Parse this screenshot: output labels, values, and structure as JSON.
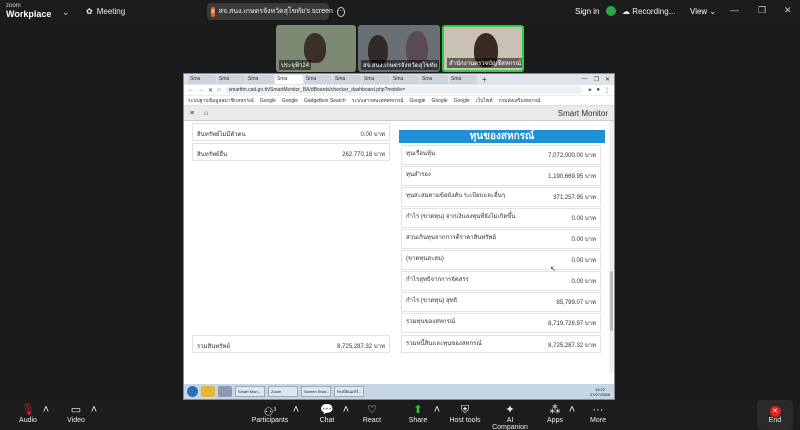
{
  "zoom": {
    "logo_top": "zoom",
    "logo_bottom": "Workplace",
    "meeting_label": "Meeting",
    "share_title": "สจ.สนง.เกษตรจังหวัดสุโขทัย's screen",
    "share_initial": "ส",
    "sign_in": "Sign in",
    "recording": "Recording...",
    "view": "View",
    "participants_count": "3",
    "colors": {
      "active_border": "#2ecc40",
      "share_green": "#28a745",
      "end_red": "#e02020"
    }
  },
  "tiles": [
    {
      "name": "ประจุฟ้า24"
    },
    {
      "name": "สจ.สนง.เกษตรจังหวัดสุโขทัย"
    },
    {
      "name": "สำนักงานตรวจบัญชีสหกรณ์..."
    }
  ],
  "browser": {
    "tabs": [
      "Sma",
      "Sma",
      "Sma",
      "Sma",
      "Sma",
      "Sma",
      "Sma",
      "Sma",
      "Sma",
      "Sma"
    ],
    "url": "smartfm.cad.go.th/SmartMonitor_BA/dBoards/checker_dashboard.php?mobile=",
    "bookmarks": [
      "ระบบฐานข้อมูลสมาชิกสหกรณ์",
      "Google",
      "Google",
      "Gadgetbox Search",
      "ระบบสารสนเทศสหกรณ์",
      "Google",
      "Google",
      "Google",
      "เว็บไซต์",
      "กรมส่งเสริมสหกรณ์"
    ],
    "app_title": "Smart Monitor",
    "menu_icon": "hamburger-icon",
    "home_icon": "home-icon"
  },
  "assets": {
    "rows": [
      {
        "label": "สินทรัพย์ไม่มีตัวตน",
        "value": "0.00 บาท"
      },
      {
        "label": "สินทรัพย์อื่น",
        "value": "262,770.18 บาท"
      }
    ],
    "total_label": "รวมสินทรัพย์",
    "total_value": "8,725,287.32 บาท"
  },
  "equity": {
    "header": "ทุนของสหกรณ์",
    "rows": [
      {
        "label": "ทุนเรือนหุ้น",
        "value": "7,072,000.00 บาท"
      },
      {
        "label": "ทุนสำรอง",
        "value": "1,190,669.95 บาท"
      },
      {
        "label": "ทุนสะสมตามข้อบังคับ ระเบียบและอื่นๆ",
        "value": "371,257.95 บาท"
      },
      {
        "label": "กำไร (ขาดทุน) จากเงินลงทุนที่ยังไม่เกิดขึ้น",
        "value": "0.00 บาท"
      },
      {
        "label": "ส่วนเกินทุนจากการตีราคาสินทรัพย์",
        "value": "0.00 บาท"
      },
      {
        "label": "(ขาดทุนสะสม)",
        "value": "0.00 บาท"
      },
      {
        "label": "กำไรสุทธิจากการจัดสรร",
        "value": "0.00 บาท"
      },
      {
        "label": "กำไร (ขาดทุน) สุทธิ",
        "value": "85,799.07 บาท"
      },
      {
        "label": "รวมทุนของสหกรณ์",
        "value": "8,719,726.97 บาท"
      }
    ],
    "total_label": "รวมหนี้สินและทุนของสหกรณ์",
    "total_value": "8,725,287.32 บาท"
  },
  "taskbar": {
    "apps": [
      "Smart Mon...",
      "Zoom",
      "Screen Shar...",
      "ทะเบียนแชร์..."
    ],
    "time": "15:22",
    "date": "07/07/2568"
  },
  "toolbar": {
    "audio": "Audio",
    "video": "Video",
    "participants": "Participants",
    "chat": "Chat",
    "react": "React",
    "share": "Share",
    "host_tools": "Host tools",
    "ai_companion": "AI Companion",
    "apps": "Apps",
    "more": "More",
    "end": "End"
  }
}
